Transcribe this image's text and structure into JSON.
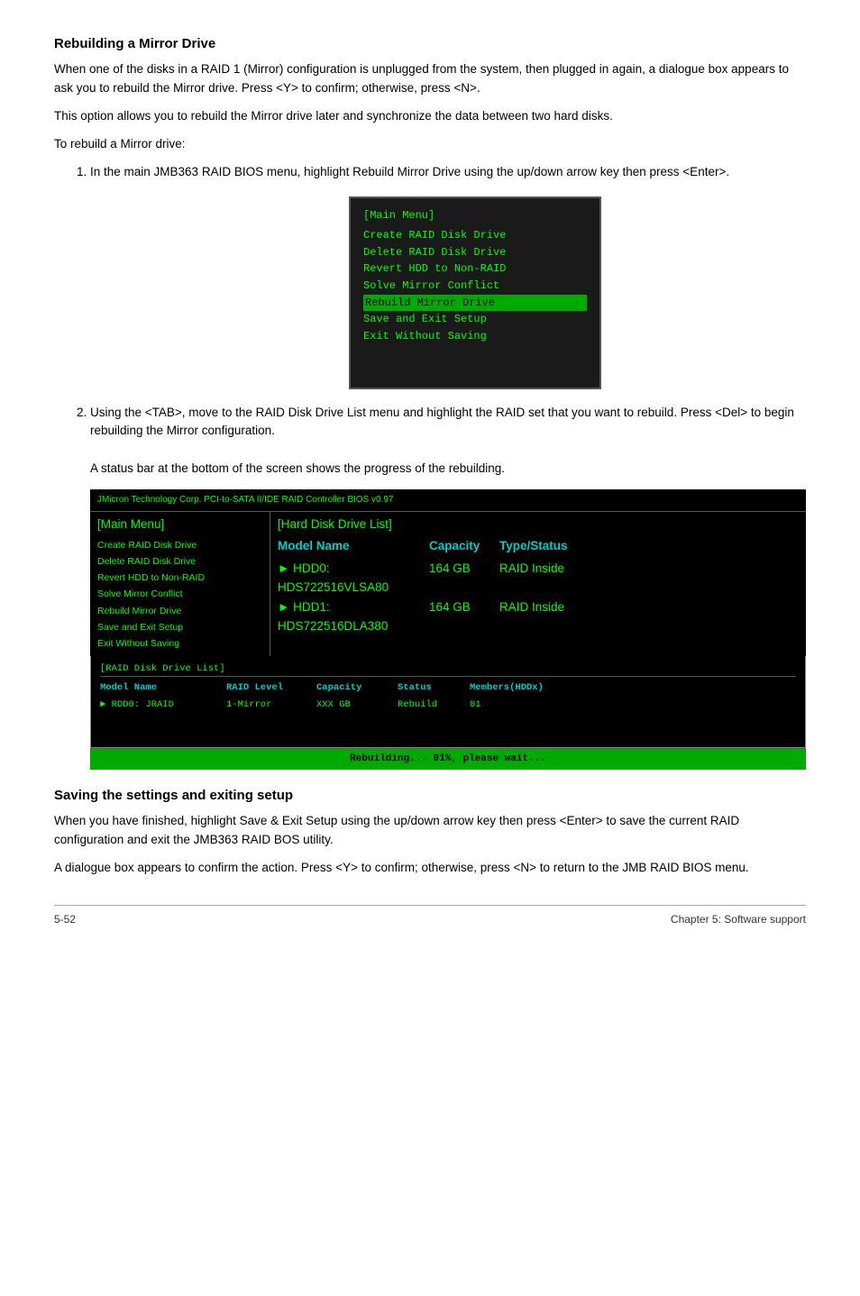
{
  "page": {
    "section1_title": "Rebuilding a Mirror Drive",
    "section1_para1": "When one of the disks in a RAID 1 (Mirror) configuration is unplugged from the system, then plugged in again, a dialogue box appears to ask you to rebuild the Mirror drive. Press <Y> to confirm; otherwise, press <N>.",
    "section1_para2": "This option allows you to rebuild the Mirror drive later and synchronize the data between two hard disks.",
    "section1_para3": "To rebuild a Mirror drive:",
    "step1_text": "In the main JMB363 RAID BIOS menu, highlight Rebuild Mirror Drive using the up/down arrow key then press <Enter>.",
    "step2_text": "Using the <TAB>, move to the RAID Disk Drive List menu and highlight the RAID set that you want to rebuild. Press <Del> to begin rebuilding the Mirror configuration.",
    "step2_note": "A status bar at the bottom of the screen shows the progress of the rebuilding.",
    "bios_menu": {
      "title": "[Main Menu]",
      "items": [
        "Create RAID Disk Drive",
        "Delete RAID Disk Drive",
        "Revert HDD to Non-RAID",
        "Solve Mirror Conflict",
        "Rebuild Mirror Drive",
        "Save and Exit Setup",
        "Exit Without Saving"
      ],
      "highlighted": "Rebuild Mirror Drive"
    },
    "screenshot": {
      "header": "JMicron Technology Corp.  PCI-to-SATA II/IDE RAID Controller BIOS v0.97",
      "left_panel_title": "[Main Menu]",
      "left_items": [
        "Create RAID Disk Drive",
        "Delete RAID Disk Drive",
        "Revert HDD to Non-RAID",
        "Solve Mirror Conflict",
        "Rebuild Mirror Drive",
        "Save and Exit Setup",
        "Exit Without Saving"
      ],
      "right_panel_title": "[Hard Disk Drive List]",
      "right_cols": [
        "Model Name",
        "Capacity",
        "Type/Status"
      ],
      "right_rows": [
        {
          "arrow": "►",
          "name": "HDD0: HDS722516VLSA80",
          "capacity": "164 GB",
          "type": "RAID Inside"
        },
        {
          "arrow": "►",
          "name": "HDD1: HDS722516DLA380",
          "capacity": "164 GB",
          "type": "RAID Inside"
        }
      ]
    },
    "raid_list": {
      "title": "[RAID Disk Drive List]",
      "cols": [
        "Model Name",
        "RAID Level",
        "Capacity",
        "Status",
        "Members(HDDx)"
      ],
      "rows": [
        {
          "arrow": "►",
          "name": "RDD0:  JRAID",
          "level": "1-Mirror",
          "capacity": "XXX GB",
          "status": "Rebuild",
          "members": "01"
        }
      ]
    },
    "rebuild_bar": "Rebuilding... 01%, please wait...",
    "section2_title": "Saving the settings and exiting setup",
    "section2_para1": "When you have finished, highlight Save & Exit Setup using the up/down arrow key then press <Enter> to save the current RAID configuration and exit the JMB363 RAID BOS utility.",
    "section2_para2": "A dialogue box appears to confirm the action. Press <Y> to confirm; otherwise, press <N> to return to the JMB RAID BIOS menu.",
    "footer_left": "5-52",
    "footer_right": "Chapter 5: Software support"
  }
}
